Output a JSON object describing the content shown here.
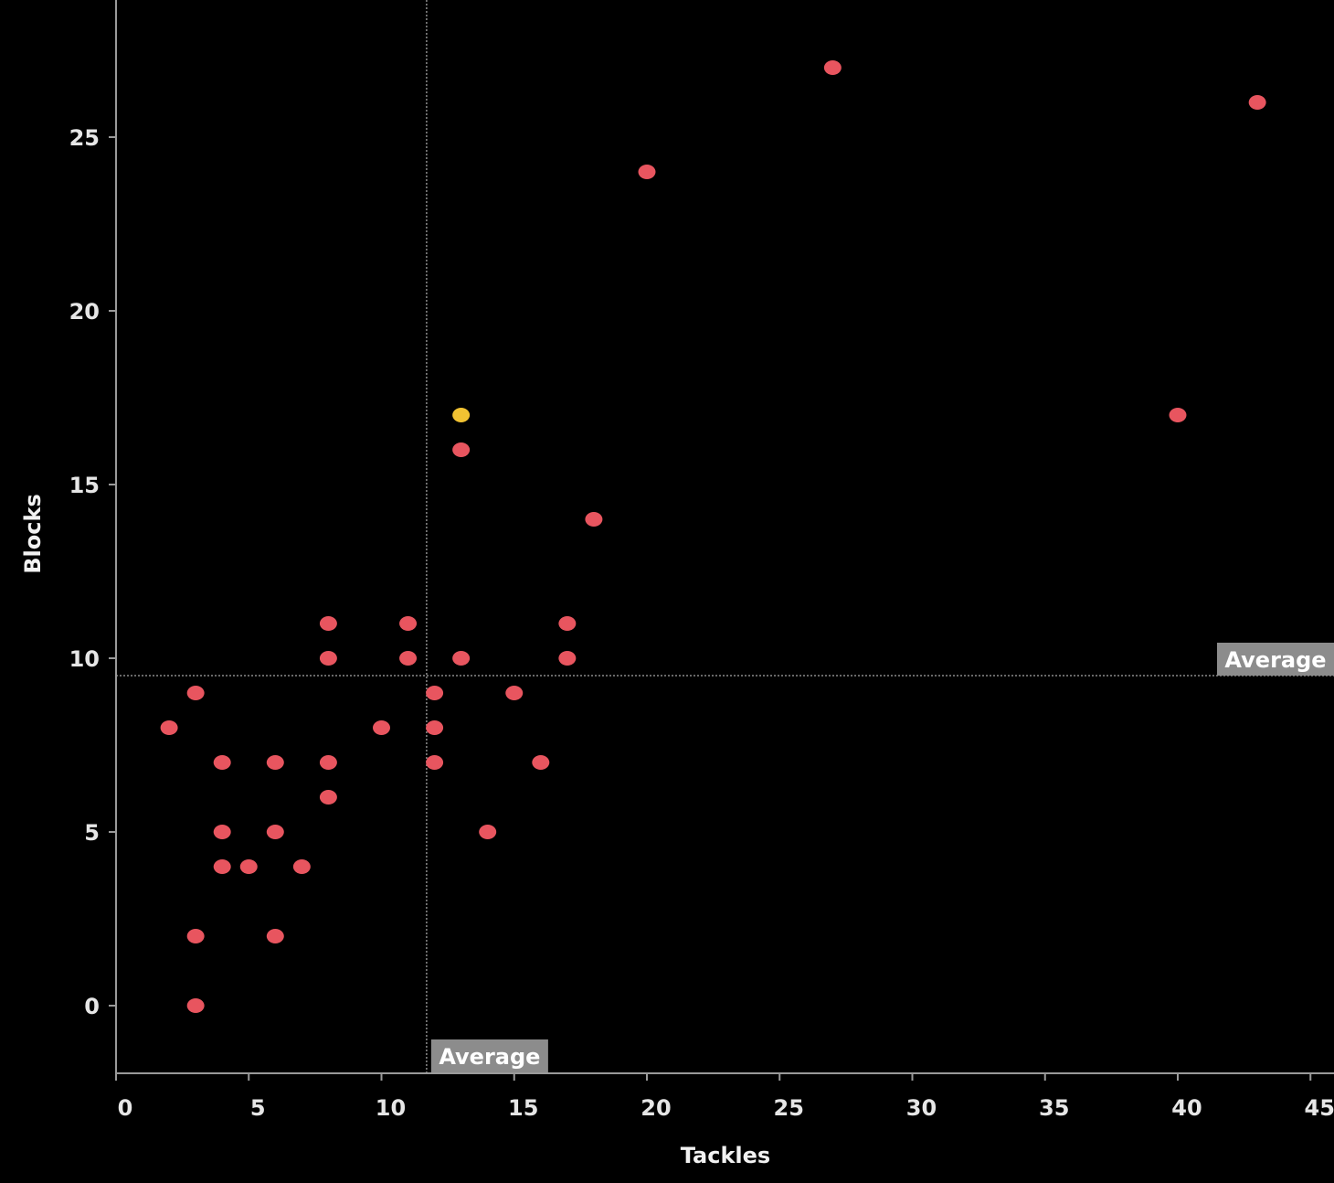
{
  "chart_data": {
    "type": "scatter",
    "title": "",
    "xlabel": "Tackles",
    "ylabel": "Blocks",
    "xlim": [
      0,
      45
    ],
    "ylim": [
      -2,
      29
    ],
    "x_ticks": [
      0,
      5,
      10,
      15,
      20,
      25,
      30,
      35,
      40,
      45
    ],
    "y_ticks": [
      0,
      5,
      10,
      15,
      20,
      25
    ],
    "grid": false,
    "average_x": 11.7,
    "average_y": 9.5,
    "average_x_label": "Average",
    "average_y_label": "Average",
    "colors": {
      "point": "#e8555f",
      "highlight": "#f1c232",
      "average_line": "#8a8a8a",
      "average_label_bg": "#8c8c8c",
      "axis": "#9a9a9a"
    },
    "points": [
      {
        "x": 43,
        "y": 26
      },
      {
        "x": 27,
        "y": 27
      },
      {
        "x": 20,
        "y": 24
      },
      {
        "x": 40,
        "y": 17
      },
      {
        "x": 13,
        "y": 17,
        "highlight": true
      },
      {
        "x": 13,
        "y": 16
      },
      {
        "x": 18,
        "y": 14
      },
      {
        "x": 8,
        "y": 11
      },
      {
        "x": 11,
        "y": 11
      },
      {
        "x": 17,
        "y": 11
      },
      {
        "x": 8,
        "y": 10
      },
      {
        "x": 11,
        "y": 10
      },
      {
        "x": 13,
        "y": 10
      },
      {
        "x": 17,
        "y": 10
      },
      {
        "x": 3,
        "y": 9
      },
      {
        "x": 12,
        "y": 9
      },
      {
        "x": 15,
        "y": 9
      },
      {
        "x": 2,
        "y": 8
      },
      {
        "x": 10,
        "y": 8
      },
      {
        "x": 12,
        "y": 8
      },
      {
        "x": 4,
        "y": 7
      },
      {
        "x": 6,
        "y": 7
      },
      {
        "x": 8,
        "y": 7
      },
      {
        "x": 12,
        "y": 7
      },
      {
        "x": 16,
        "y": 7
      },
      {
        "x": 8,
        "y": 6
      },
      {
        "x": 4,
        "y": 5
      },
      {
        "x": 6,
        "y": 5
      },
      {
        "x": 14,
        "y": 5
      },
      {
        "x": 4,
        "y": 4
      },
      {
        "x": 5,
        "y": 4
      },
      {
        "x": 7,
        "y": 4
      },
      {
        "x": 3,
        "y": 2
      },
      {
        "x": 6,
        "y": 2
      },
      {
        "x": 3,
        "y": 0
      }
    ]
  }
}
